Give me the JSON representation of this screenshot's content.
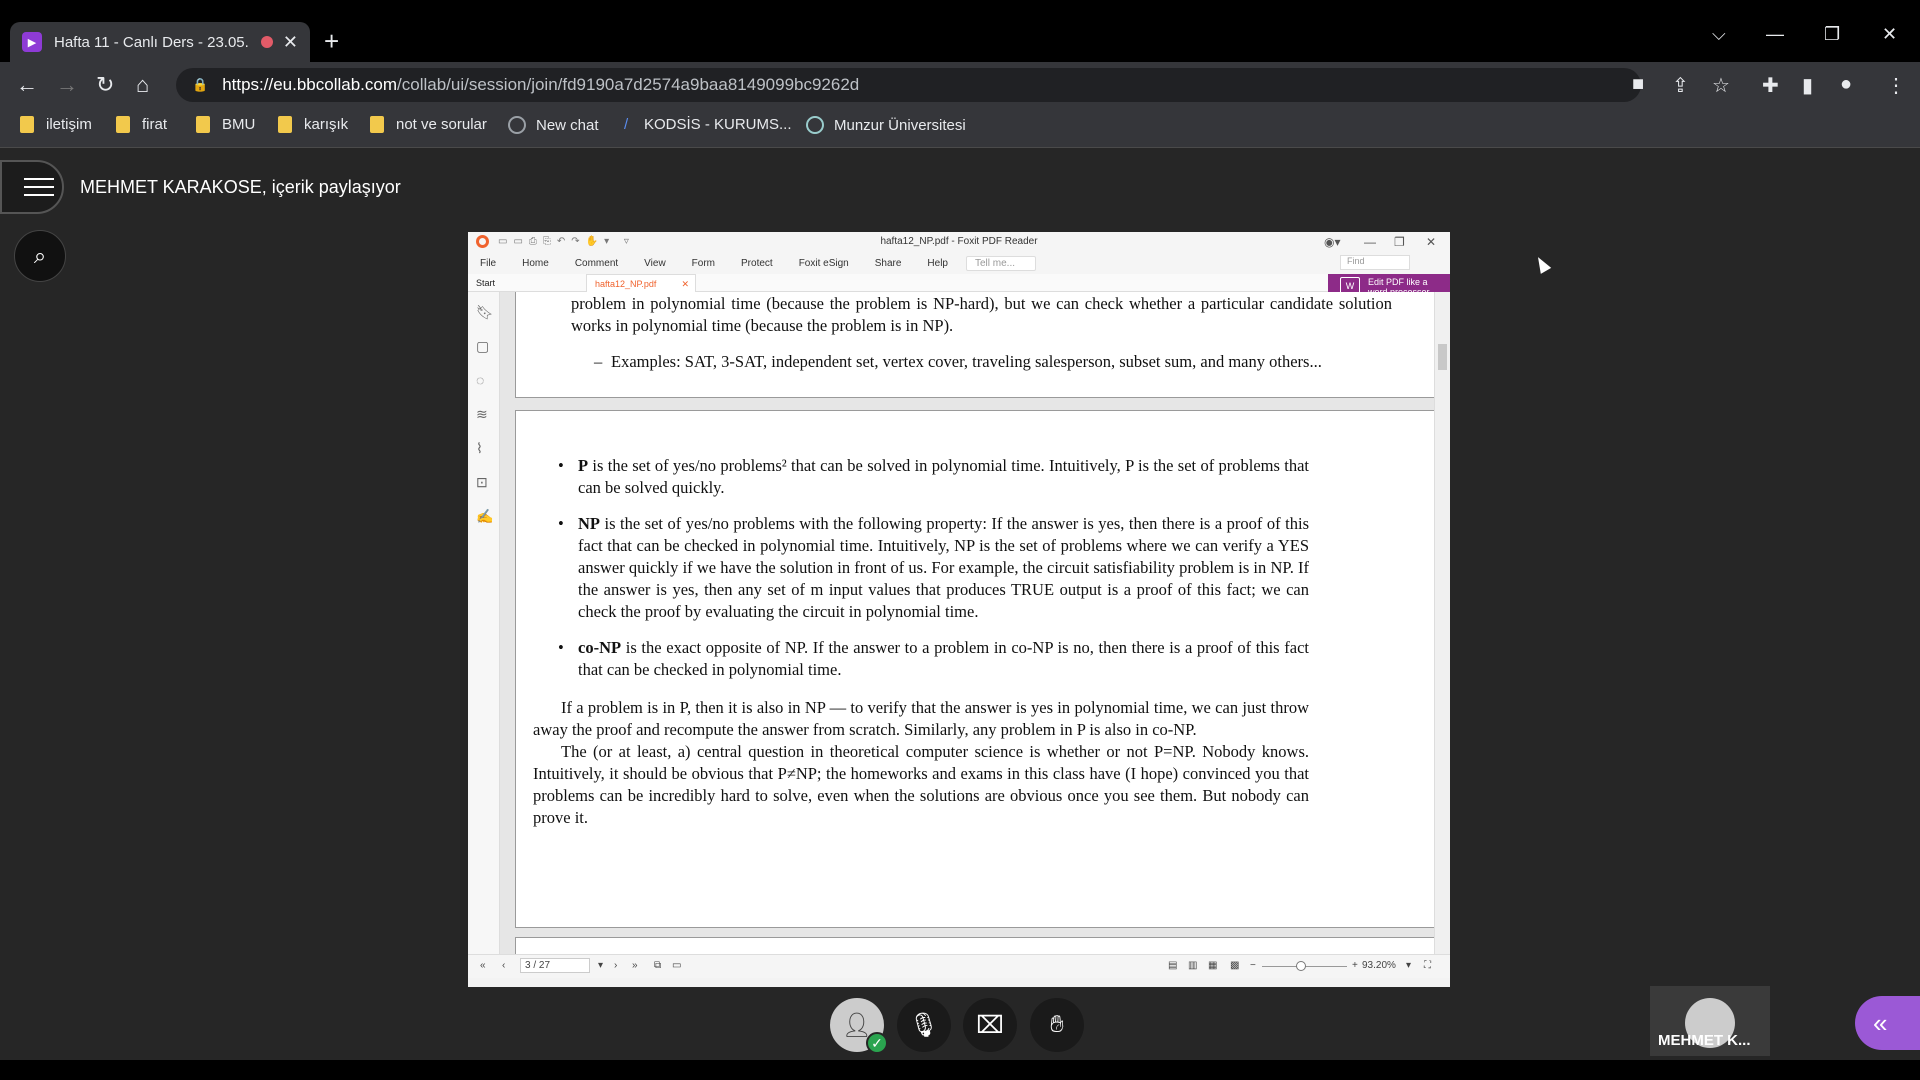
{
  "browser": {
    "tab_title": "Hafta 11 - Canlı Ders - 23.05.",
    "tab_close": "✕",
    "new_tab": "+",
    "url_host": "https://eu.bbcollab.com",
    "url_path": "/collab/ui/session/join/fd9190a7d2574a9baa8149099bc9262d",
    "window_controls": {
      "dropdown": "⌵",
      "minimize": "—",
      "restore": "❐",
      "close": "✕"
    },
    "nav": {
      "back": "←",
      "forward": "→",
      "reload": "↻",
      "home": "⌂"
    },
    "bookmarks": [
      {
        "label": "iletişim",
        "icon": "folder-icon"
      },
      {
        "label": "firat",
        "icon": "folder-icon"
      },
      {
        "label": "BMU",
        "icon": "folder-icon"
      },
      {
        "label": "karışık",
        "icon": "folder-icon"
      },
      {
        "label": "not ve sorular",
        "icon": "folder-icon"
      },
      {
        "label": "New chat",
        "icon": "chatgpt-icon"
      },
      {
        "label": "KODSİS - KURUMS...",
        "icon": "kodsis-icon"
      },
      {
        "label": "Munzur Üniversitesi",
        "icon": "university-icon"
      }
    ]
  },
  "collab": {
    "share_title": "MEHMET KARAKOSE, içerik paylaşıyor",
    "participant_name": "MEHMET K...",
    "controls": [
      "avatar-status",
      "microphone-off",
      "camera-off",
      "raise-hand"
    ]
  },
  "pdf": {
    "window_title": "hafta12_NP.pdf - Foxit PDF Reader",
    "menu": [
      "File",
      "Home",
      "Comment",
      "View",
      "Form",
      "Protect",
      "Foxit eSign",
      "Share",
      "Help"
    ],
    "tell_me": "Tell me...",
    "find": "Find",
    "tabs": {
      "start": "Start",
      "doc": "hafta12_NP.pdf"
    },
    "edit_banner": "Edit PDF like a word processor",
    "page_indicator": "3 / 27",
    "zoom": "93.20%",
    "page1": {
      "line1": "problem in polynomial time (because the problem is NP-hard), but we can check whether a particular candidate solution works in polynomial time (because the problem is in NP).",
      "examples": "Examples: SAT, 3-SAT, independent set, vertex cover, traveling salesperson, subset sum, and many others..."
    },
    "page2": {
      "b1_head": "P",
      "b1_text": " is the set of yes/no problems² that can be solved in polynomial time. Intuitively, P is the set of problems that can be solved quickly.",
      "b2_head": "NP",
      "b2_text": " is the set of yes/no problems with the following property: If the answer is yes, then there is a proof of this fact that can be checked in polynomial time. Intuitively, NP is the set of problems where we can verify a YES answer quickly if we have the solution in front of us. For example, the circuit satisfiability problem is in NP. If the answer is yes, then any set of m input values that produces TRUE output is a proof of this fact; we can check the proof by evaluating the circuit in polynomial time.",
      "b3_head": "co-NP",
      "b3_text": " is the exact opposite of NP. If the answer to a problem in co-NP is no, then there is a proof of this fact that can be checked in polynomial time.",
      "para1": "If a problem is in P, then it is also in NP — to verify that the answer is yes in polynomial time, we can just throw away the proof and recompute the answer from scratch. Similarly, any problem in P is also in co-NP.",
      "para2": "The (or at least, a) central question in theoretical computer science is whether or not P=NP. Nobody knows. Intuitively, it should be obvious that P≠NP; the homeworks and exams in this class have (I hope) convinced you that problems can be incredibly hard to solve, even when the solutions are obvious once you see them. But nobody can prove it."
    }
  }
}
